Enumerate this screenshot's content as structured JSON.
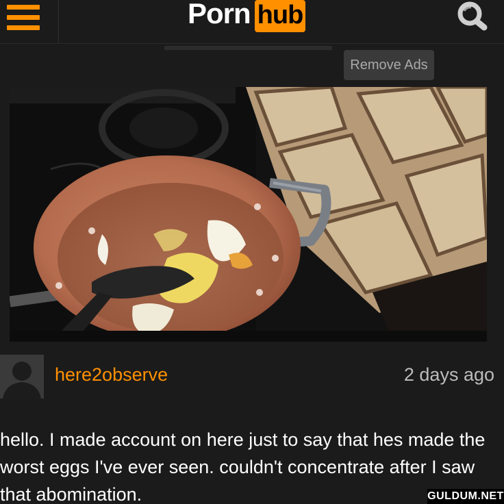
{
  "header": {
    "menu_icon": "hamburger-menu-icon",
    "logo_word": "Porn",
    "logo_badge": "hub",
    "search_icon": "search-icon",
    "accent_color": "#ff9000"
  },
  "ad_bar": {
    "remove_ads_label": "Remove Ads"
  },
  "video": {
    "thumbnail_icon": "video-thumbnail-image"
  },
  "comment": {
    "avatar_icon": "default-user-avatar-icon",
    "username": "here2observe",
    "timestamp": "2 days ago",
    "text": "hello. I made account on here just to say that hes made the worst eggs I've ever seen. couldn't concentrate after I saw that abomination."
  },
  "watermark": "GULDUM.NET"
}
